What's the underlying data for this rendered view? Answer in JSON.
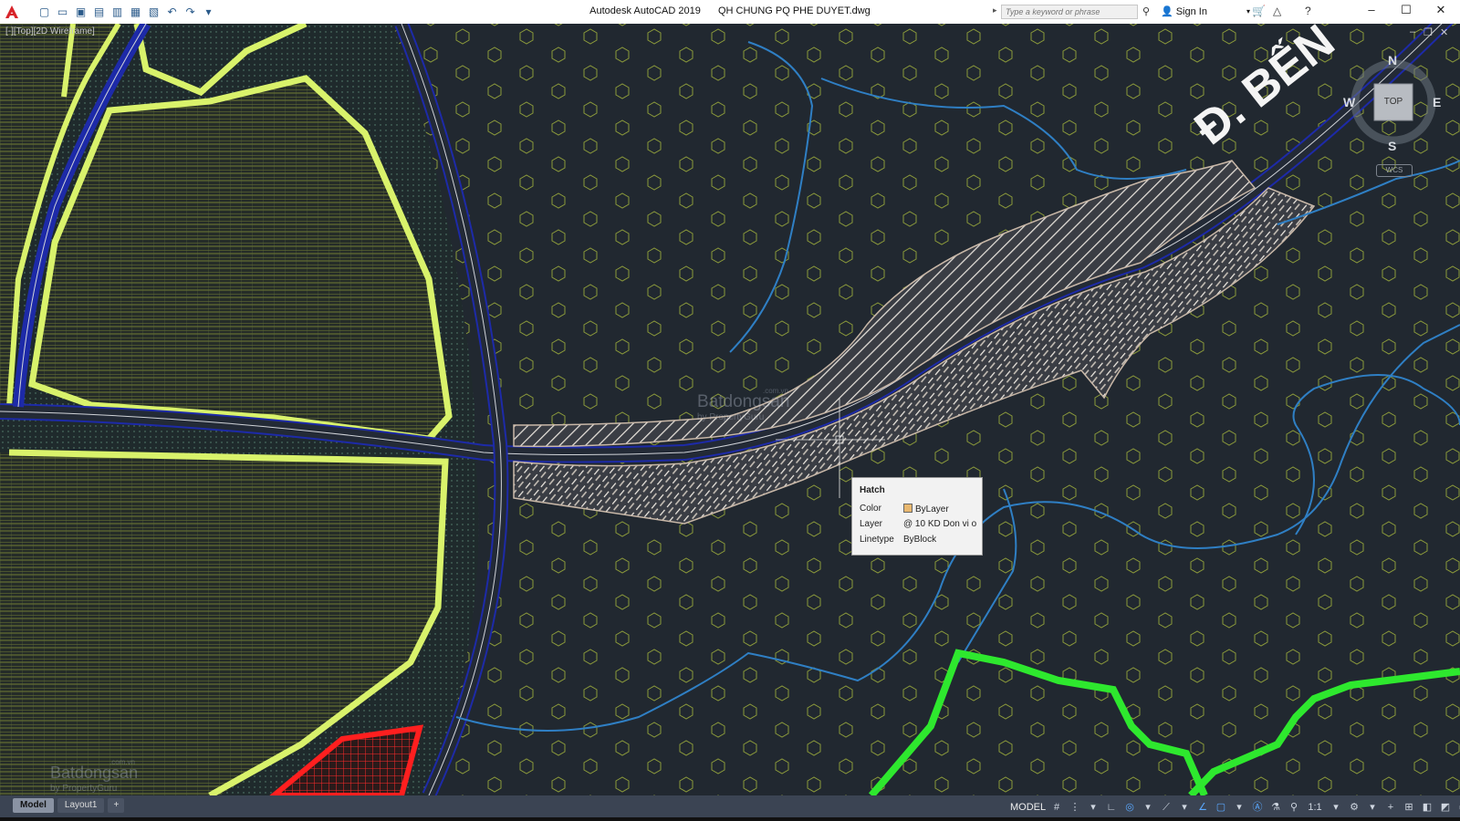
{
  "titlebar": {
    "app_title": "Autodesk AutoCAD 2019",
    "file_name": "QH CHUNG PQ PHE DUYET.dwg",
    "search_placeholder": "Type a keyword or phrase",
    "sign_in": "Sign In",
    "quick_access_icons": [
      "new-icon",
      "open-icon",
      "save-icon",
      "save-as-icon",
      "publish-icon",
      "plot-preview-icon",
      "print-icon",
      "undo-icon",
      "redo-icon",
      "customize-icon"
    ]
  },
  "viewport": {
    "label": "[-][Top][2D Wireframe]",
    "road_label": "Đ. BẾN"
  },
  "viewcube": {
    "north": "N",
    "south": "S",
    "east": "E",
    "west": "W",
    "face": "TOP",
    "wcs": "WCS"
  },
  "tooltip": {
    "title": "Hatch",
    "rows": [
      {
        "label": "Color",
        "value": "ByLayer"
      },
      {
        "label": "Layer",
        "value": "@ 10 KD Don vi o"
      },
      {
        "label": "Linetype",
        "value": "ByBlock"
      }
    ]
  },
  "watermark": {
    "brand": "Batdongsan",
    "tagline": "by PropertyGuru",
    "domain": ".com.vn"
  },
  "statusbar": {
    "tabs": [
      "Model",
      "Layout1",
      "+"
    ],
    "model": "MODEL",
    "scale": "1:1"
  },
  "colors": {
    "background": "#212830",
    "yellow_boundary": "#d9f26b",
    "green_boundary": "#2ee82e",
    "red_zone": "#ff1f1f",
    "blue_stream": "#2f7fc4",
    "road_outline": "#1d2aa8"
  }
}
